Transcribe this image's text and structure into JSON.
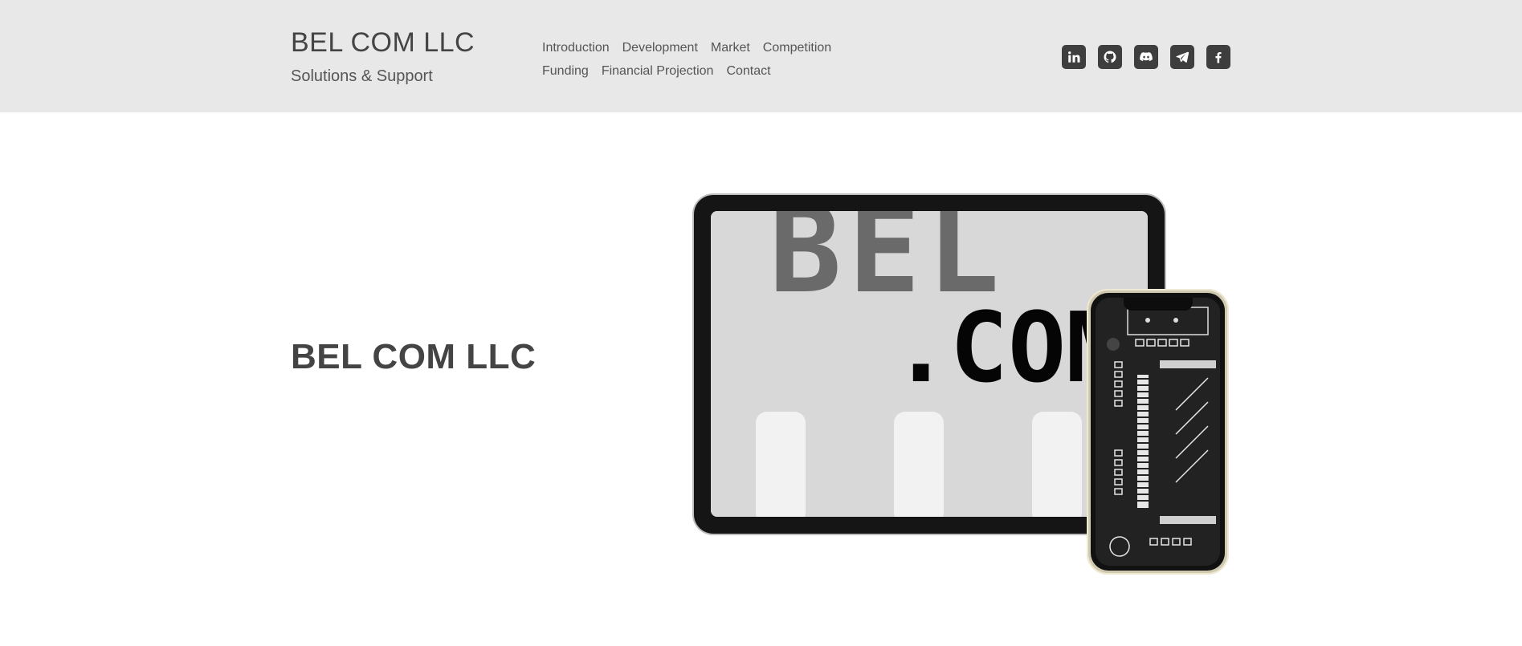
{
  "header": {
    "title": "BEL COM LLC",
    "subtitle": "Solutions & Support",
    "nav": {
      "row1": [
        "Introduction",
        "Development",
        "Market",
        "Competition"
      ],
      "row2": [
        "Funding",
        "Financial Projection",
        "Contact"
      ]
    },
    "social_icons": [
      "linkedin-icon",
      "github-icon",
      "discord-icon",
      "telegram-icon",
      "facebook-icon"
    ]
  },
  "hero": {
    "title": "BEL COM LLC",
    "tablet_text_top": "BEL",
    "tablet_text_main": ".COM"
  },
  "colors": {
    "header_bg": "#e8e8e8",
    "text": "#444444",
    "icon_bg": "#3e3e3e"
  }
}
